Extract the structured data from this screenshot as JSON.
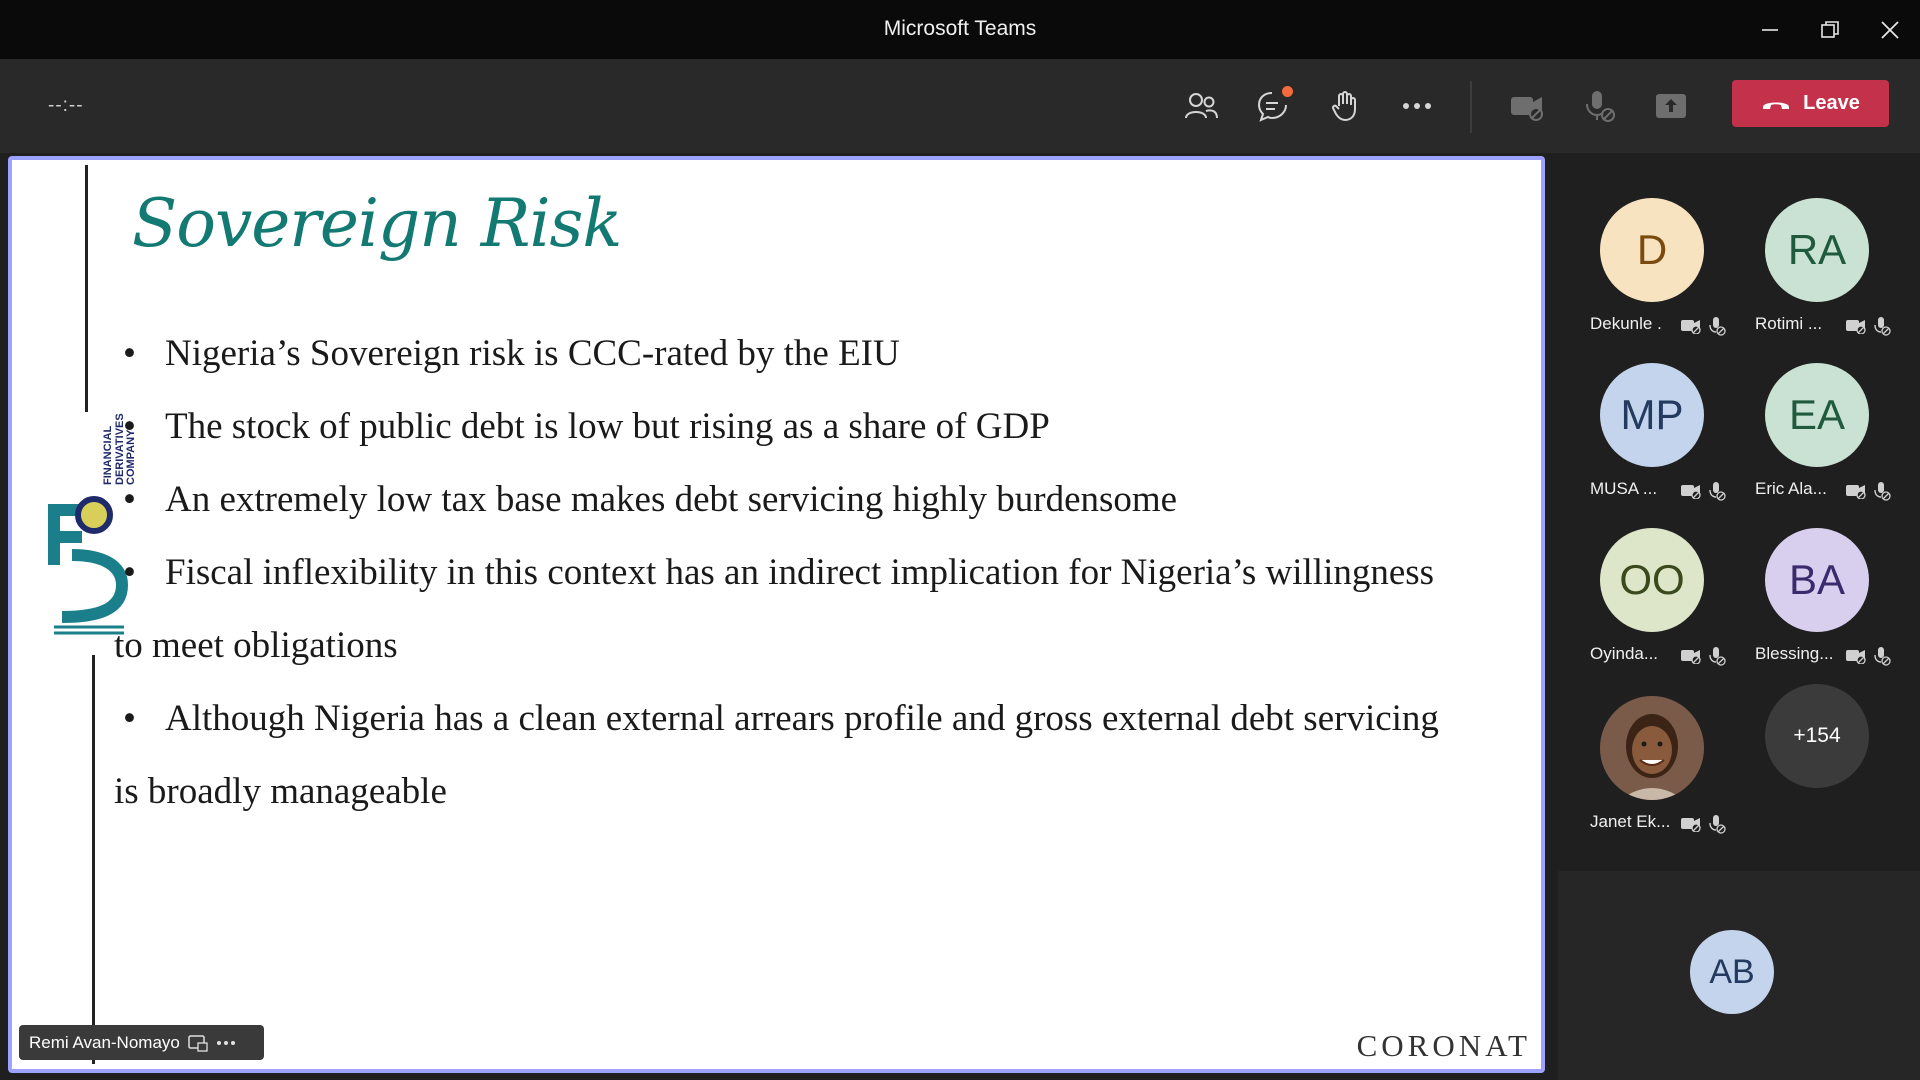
{
  "window": {
    "title": "Microsoft Teams"
  },
  "toolbar": {
    "timer": "--:--",
    "leave_label": "Leave"
  },
  "slide": {
    "title": "Sovereign Risk",
    "bullets": [
      "Nigeria’s Sovereign risk is CCC-rated by the EIU",
      "The stock of public debt is low but rising as a share of GDP",
      "An extremely low tax base makes debt servicing highly burdensome",
      "Fiscal inflexibility in this context has an indirect implication for Nigeria’s willingness",
      "to meet obligations",
      "Although Nigeria has a clean external arrears profile and gross external debt servicing",
      "is broadly manageable"
    ],
    "logo_text_1": "FINANCIAL",
    "logo_text_2": "DERIVATIVES",
    "logo_text_3": "COMPANY",
    "brand": "CORONAT"
  },
  "presenter": {
    "name": "Remi Avan-Nomayo"
  },
  "participants": [
    {
      "initials": "D",
      "name": "Dekunle .",
      "bg": "#f8e3c0",
      "fg": "#7a4a0f"
    },
    {
      "initials": "RA",
      "name": "Rotimi ...",
      "bg": "#c9e2d3",
      "fg": "#1f5a3c"
    },
    {
      "initials": "MP",
      "name": "MUSA ...",
      "bg": "#c3d4ec",
      "fg": "#243a5e"
    },
    {
      "initials": "EA",
      "name": "Eric Ala...",
      "bg": "#c9e2d3",
      "fg": "#1f5a3c"
    },
    {
      "initials": "OO",
      "name": "Oyinda...",
      "bg": "#dde6c9",
      "fg": "#3b4a1c"
    },
    {
      "initials": "BA",
      "name": "Blessing...",
      "bg": "#d8cfee",
      "fg": "#3c2a6e"
    },
    {
      "initials": "",
      "name": "Janet Ek...",
      "bg": "#6b4a3a",
      "fg": "#fff"
    }
  ],
  "more_count": "+154",
  "self": {
    "initials": "AB"
  }
}
